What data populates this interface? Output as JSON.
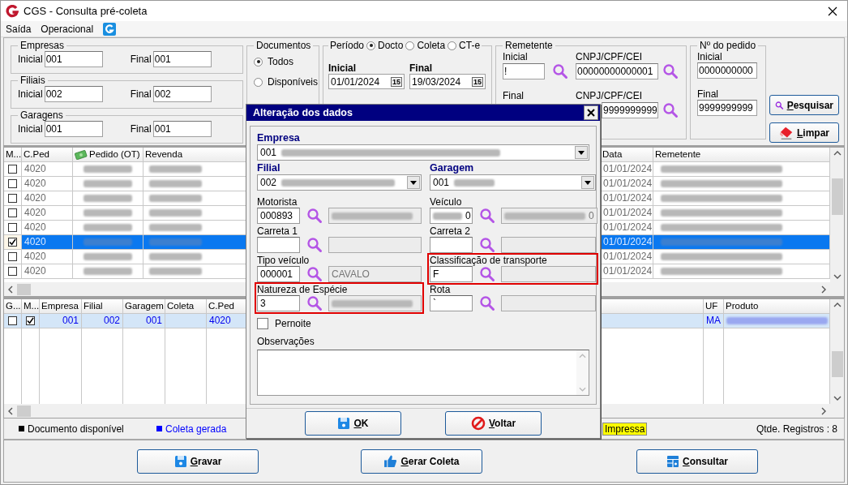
{
  "window": {
    "title": "CGS - Consulta pré-coleta"
  },
  "menu": [
    {
      "label": "Saída"
    },
    {
      "label": "Operacional"
    }
  ],
  "filters": {
    "ranges": [
      {
        "title": "Empresas",
        "start_label": "Inicial",
        "start": "001",
        "end_label": "Final",
        "end": "001"
      },
      {
        "title": "Filiais",
        "start_label": "Inicial",
        "start": "002",
        "end_label": "Final",
        "end": "002"
      },
      {
        "title": "Garagens",
        "start_label": "Inicial",
        "start": "001",
        "end_label": "Final",
        "end": "001"
      }
    ],
    "documentos": {
      "title": "Documentos",
      "options": [
        {
          "label": "Todos",
          "selected": true
        },
        {
          "label": "Disponíveis",
          "selected": false
        }
      ]
    },
    "periodo": {
      "title": "Período",
      "options": [
        {
          "label": "Docto",
          "selected": true
        },
        {
          "label": "Coleta",
          "selected": false
        },
        {
          "label": "CT-e",
          "selected": false
        }
      ],
      "start_label": "Inicial",
      "start": "01/01/2024",
      "start_calendar": "15",
      "end_label": "Final",
      "end": "19/03/2024",
      "end_calendar": "15"
    },
    "remetente": {
      "title": "Remetente",
      "start_label": "Inicial",
      "start": "!",
      "start_doc_label": "CNPJ/CPF/CEI",
      "start_doc": "00000000000001",
      "end_label": "Final",
      "end_doc_label": "CNPJ/CPF/CEI",
      "end_doc": "9999999999"
    },
    "pedido": {
      "title": "Nº do pedido",
      "start_label": "Inicial",
      "start": "0000000000",
      "end_label": "Final",
      "end": "9999999999"
    },
    "buttons": [
      {
        "label": "Pesquisar",
        "kind": "search"
      },
      {
        "label": "Limpar",
        "kind": "clear"
      }
    ]
  },
  "orders_table": {
    "columns": [
      "M...",
      "C.Ped",
      "Pedido (OT)",
      "Revenda",
      "Data",
      "Remetente"
    ],
    "rows": [
      {
        "checked": false,
        "selected": false,
        "c_ped": "4020",
        "data": "01/01/2024"
      },
      {
        "checked": false,
        "selected": false,
        "c_ped": "4020",
        "data": "01/01/2024"
      },
      {
        "checked": false,
        "selected": false,
        "c_ped": "4020",
        "data": "01/01/2024"
      },
      {
        "checked": false,
        "selected": false,
        "c_ped": "4020",
        "data": "01/01/2024"
      },
      {
        "checked": false,
        "selected": false,
        "c_ped": "4020",
        "data": "01/01/2024"
      },
      {
        "checked": true,
        "selected": true,
        "c_ped": "4020",
        "data": "01/01/2024"
      },
      {
        "checked": false,
        "selected": false,
        "c_ped": "4020",
        "data": "01/01/2024"
      },
      {
        "checked": false,
        "selected": false,
        "c_ped": "4020",
        "data": "01/01/2024"
      }
    ]
  },
  "items_table": {
    "columns": [
      "G...",
      "M...",
      "Empresa",
      "Filial",
      "Garagem",
      "Coleta",
      "C.Ped",
      "UF",
      "Produto"
    ],
    "rows": [
      {
        "g_checked": false,
        "m_checked": true,
        "empresa": "001",
        "filial": "002",
        "garagem": "001",
        "c_ped": "4020",
        "uf": "MA"
      }
    ]
  },
  "legend": [
    {
      "label": "Documento disponível",
      "kind": "square",
      "color": "#000000"
    },
    {
      "label": "Coleta gerada",
      "kind": "square",
      "color": "#0000ff"
    },
    {
      "label": "Impressa",
      "kind": "highlight",
      "color": "#ffff00"
    }
  ],
  "record_count": "Qtde. Registros : 8",
  "actions": [
    {
      "label": "Gravar",
      "kind": "save"
    },
    {
      "label": "Gerar Coleta",
      "kind": "thumb"
    },
    {
      "label": "Consultar",
      "kind": "grid"
    }
  ],
  "dialog": {
    "title": "Alteração dos dados",
    "empresa": {
      "label": "Empresa",
      "value": "001"
    },
    "filial": {
      "label": "Filial",
      "value": "002"
    },
    "garagem": {
      "label": "Garagem",
      "value": "001"
    },
    "lookups": [
      {
        "label": "Motorista",
        "code": "000893",
        "code_blurred": false,
        "description_blurred": true,
        "highlighted": false
      },
      {
        "label": "Veículo",
        "code": "0",
        "code_blurred": true,
        "description": "0",
        "description_blurred": true,
        "highlighted": false
      },
      {
        "label": "Carreta 1",
        "code_blurred": false,
        "description_blurred": false,
        "highlighted": false
      },
      {
        "label": "Carreta 2",
        "code_blurred": false,
        "description_blurred": false,
        "highlighted": false
      },
      {
        "label": "Tipo veículo",
        "code": "000001",
        "code_blurred": false,
        "description": "CAVALO",
        "description_blurred": false,
        "highlighted": false
      },
      {
        "label": "Classificação de transporte",
        "code": "F",
        "code_blurred": false,
        "description_blurred": false,
        "highlighted": true
      },
      {
        "label": "Natureza de Espécie",
        "code": "3",
        "code_blurred": false,
        "description_blurred": true,
        "highlighted": true
      },
      {
        "label": "Rota",
        "code": "`",
        "code_blurred": false,
        "description_blurred": false,
        "highlighted": false
      }
    ],
    "pernoite": {
      "label": "Pernoite",
      "checked": false
    },
    "observacoes_label": "Observações",
    "buttons": [
      {
        "label": "OK",
        "kind": "save"
      },
      {
        "label": "Voltar",
        "kind": "cancel"
      }
    ]
  }
}
